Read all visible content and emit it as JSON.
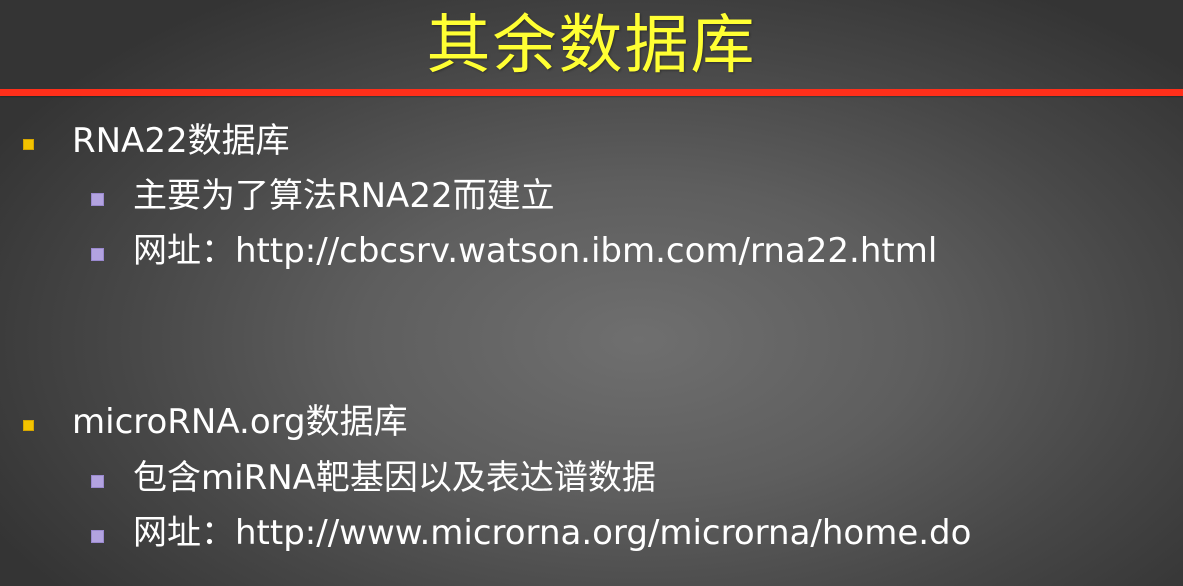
{
  "slide": {
    "title": "其余数据库",
    "colors": {
      "title": "#ffff33",
      "rule": "#ff2f1a",
      "bullet_level1": "#f3c300",
      "bullet_level2": "#b3a3e0",
      "text": "#ffffff"
    },
    "sections": [
      {
        "heading": "RNA22数据库",
        "items": [
          "主要为了算法RNA22而建立",
          "网址：http://cbcsrv.watson.ibm.com/rna22.html"
        ]
      },
      {
        "heading": "microRNA.org数据库",
        "items": [
          "包含miRNA靶基因以及表达谱数据",
          "网址：http://www.microrna.org/microrna/home.do"
        ]
      }
    ]
  }
}
